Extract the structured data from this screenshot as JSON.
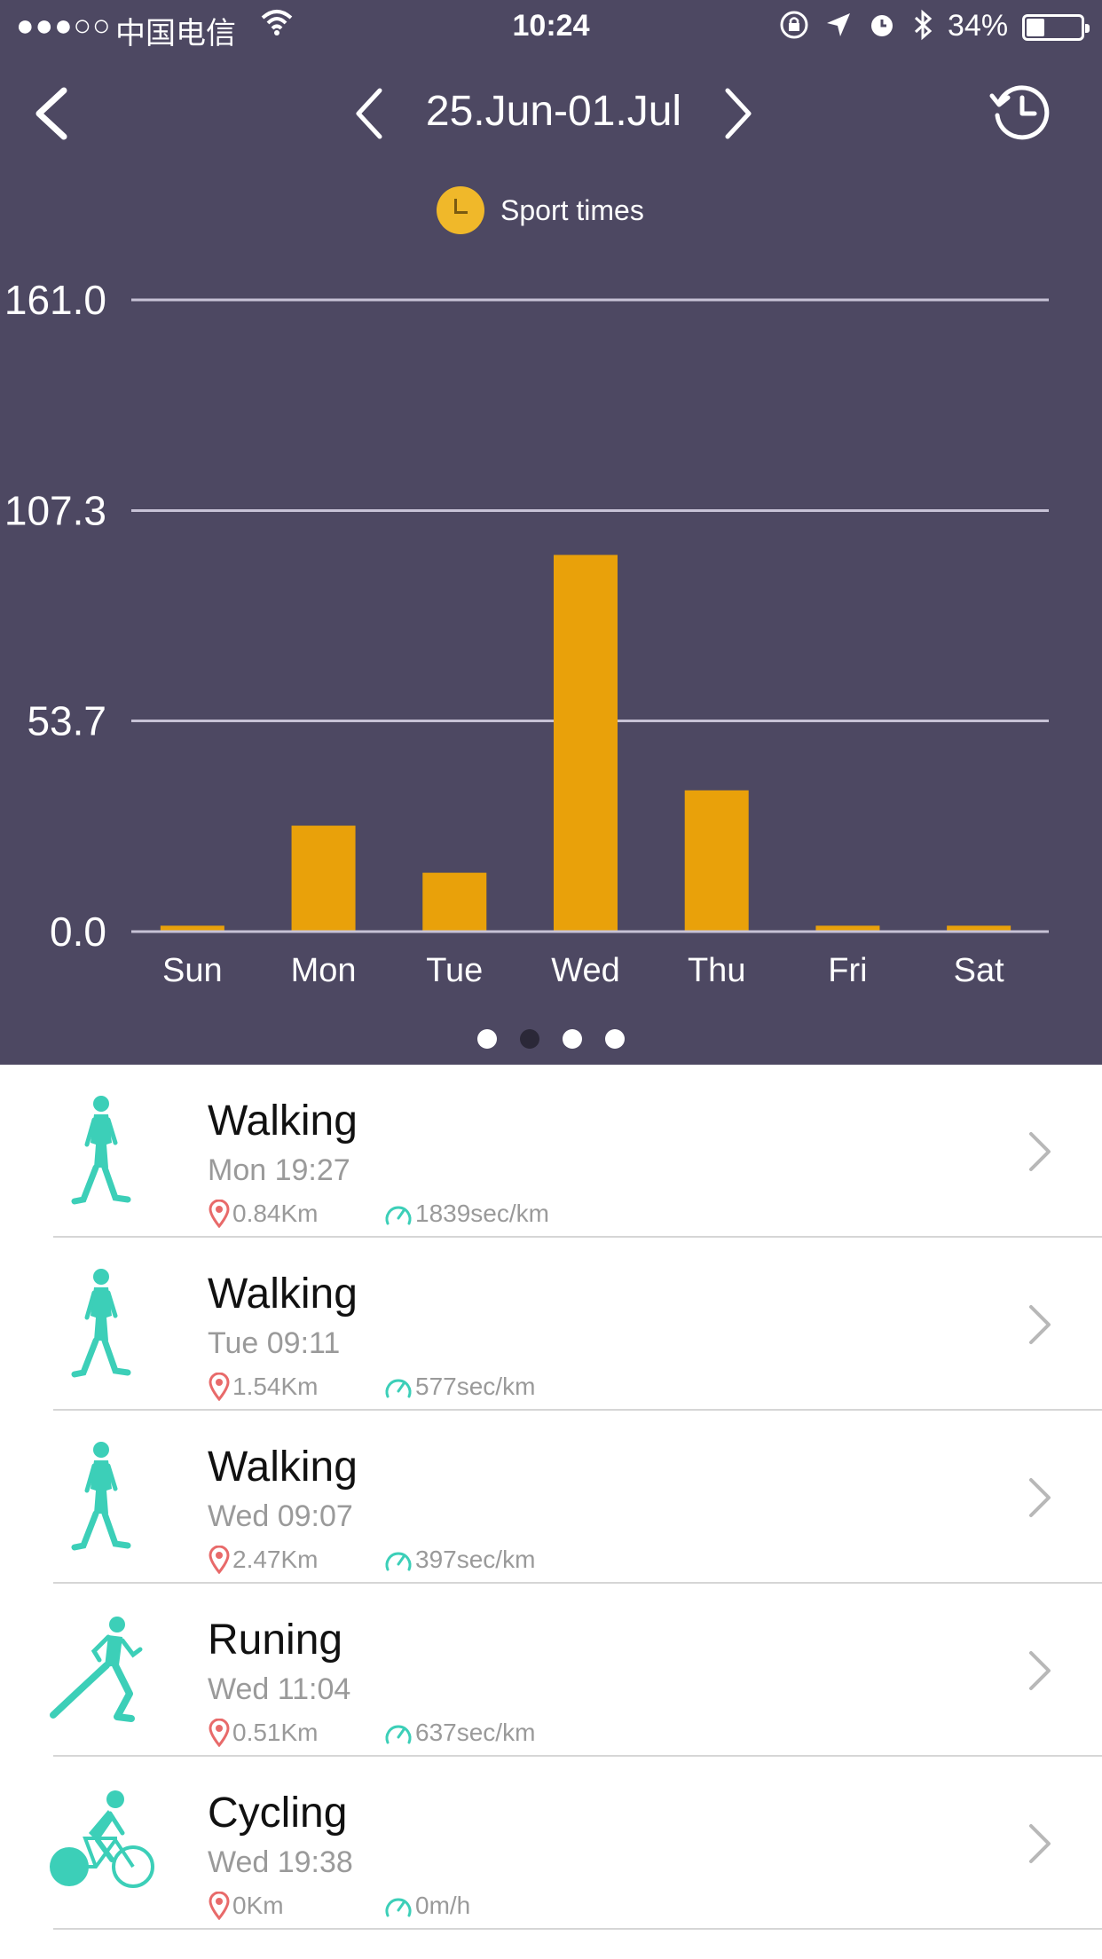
{
  "status_bar": {
    "signal": "●●●○○",
    "carrier": "中国电信",
    "time": "10:24",
    "battery": "34%",
    "battery_fraction": 0.34
  },
  "header": {
    "date_range": "25.Jun-01.Jul"
  },
  "legend": {
    "label": "Sport times"
  },
  "chart_data": {
    "type": "bar",
    "categories": [
      "Sun",
      "Mon",
      "Tue",
      "Wed",
      "Thu",
      "Fri",
      "Sat"
    ],
    "values": [
      1.5,
      27,
      15,
      96,
      36,
      1.5,
      1.5
    ],
    "y_ticks": [
      "0.0",
      "53.7",
      "107.3",
      "161.0"
    ],
    "ylim": [
      0,
      161
    ],
    "grid": true,
    "colors": {
      "bar": "#e9a10a",
      "grid": "#c7c2d6",
      "background": "#4d4862"
    }
  },
  "pager": {
    "count": 4,
    "active": 1
  },
  "activities": [
    {
      "type": "walk",
      "name": "Walking",
      "time": "Mon 19:27",
      "distance": "0.84Km",
      "pace": "1839sec/km"
    },
    {
      "type": "walk",
      "name": "Walking",
      "time": "Tue 09:11",
      "distance": "1.54Km",
      "pace": "577sec/km"
    },
    {
      "type": "walk",
      "name": "Walking",
      "time": "Wed 09:07",
      "distance": "2.47Km",
      "pace": "397sec/km"
    },
    {
      "type": "run",
      "name": "Runing",
      "time": "Wed 11:04",
      "distance": "0.51Km",
      "pace": "637sec/km"
    },
    {
      "type": "bike",
      "name": "Cycling",
      "time": "Wed 19:38",
      "distance": "0Km",
      "pace": "0m/h"
    }
  ],
  "colors": {
    "accent": "#3ccfb8",
    "pin": "#e86a6a",
    "header_bg": "#4d4862"
  }
}
